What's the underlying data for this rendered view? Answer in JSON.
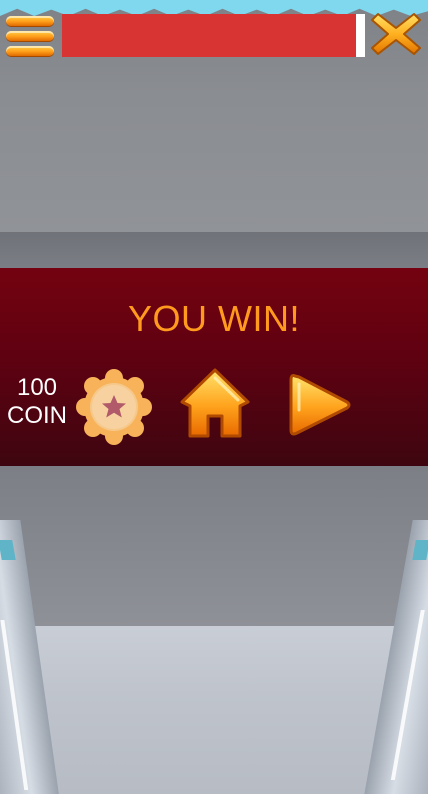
{
  "hud": {
    "progress_fraction": 0.97,
    "progress_color": "#d93434",
    "menu_icon": "hamburger-menu-icon",
    "close_icon": "close-x-icon"
  },
  "win_panel": {
    "title": "YOU WIN!",
    "reward_amount": "100",
    "reward_unit": "COIN",
    "coin_icon": "star-coin-icon",
    "home_icon": "home-icon",
    "next_icon": "play-next-icon",
    "title_color": "#ff9a1e"
  }
}
